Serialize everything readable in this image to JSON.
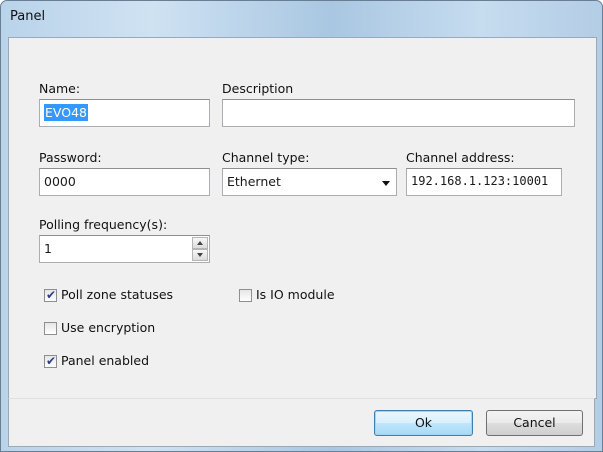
{
  "window": {
    "title": "Panel"
  },
  "fields": {
    "name": {
      "label": "Name:",
      "value": "EVO48"
    },
    "description": {
      "label": "Description",
      "value": ""
    },
    "password": {
      "label": "Password:",
      "value": "0000"
    },
    "channel_type": {
      "label": "Channel type:",
      "value": "Ethernet"
    },
    "channel_address": {
      "label": "Channel address:",
      "value": "192.168.1.123:10001"
    },
    "polling_frequency": {
      "label": "Polling frequency(s):",
      "value": "1"
    }
  },
  "checkboxes": {
    "poll_zone_statuses": {
      "label": "Poll zone statuses",
      "checked": true
    },
    "is_io_module": {
      "label": "Is IO module",
      "checked": false
    },
    "use_encryption": {
      "label": "Use encryption",
      "checked": false
    },
    "panel_enabled": {
      "label": "Panel enabled",
      "checked": true
    }
  },
  "buttons": {
    "ok": "Ok",
    "cancel": "Cancel"
  },
  "colors": {
    "selection": "#3399ff",
    "dialog_bg": "#f0f0f0",
    "check": "#2b3e8c"
  },
  "icons": {
    "dropdown": "chevron-down-icon",
    "spin_up": "arrow-up-icon",
    "spin_down": "arrow-down-icon",
    "check": "check-icon"
  }
}
